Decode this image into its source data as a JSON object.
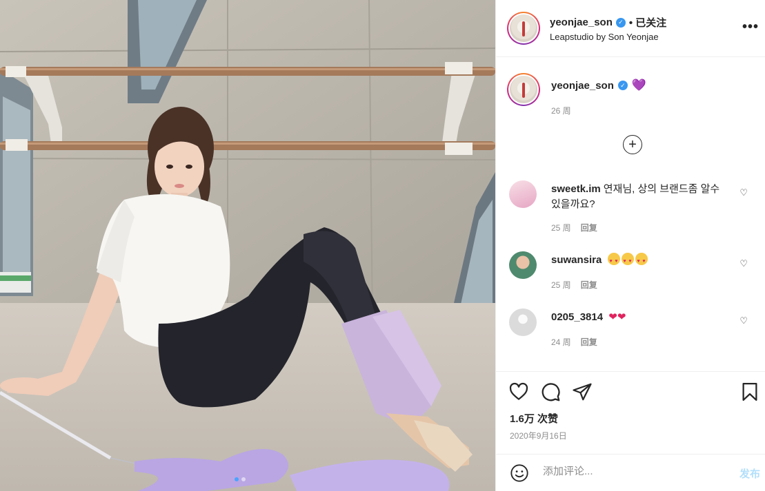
{
  "post": {
    "username": "yeonjae_son",
    "follow_status": "• 已关注",
    "location": "Leapstudio by Son Yeonjae",
    "more_label": "•••"
  },
  "caption": {
    "username": "yeonjae_son",
    "emoji": "💜",
    "time": "26 周"
  },
  "comments": [
    {
      "username": "sweetk.im",
      "text": "연재님, 상의 브랜드좀 알수 있을까요?",
      "time": "25 周",
      "reply": "回复"
    },
    {
      "username": "suwansira",
      "text": "",
      "time": "25 周",
      "reply": "回复"
    },
    {
      "username": "0205_3814",
      "text": "",
      "time": "24 周",
      "reply": "回复"
    }
  ],
  "stats": {
    "likes": "1.6万 次赞",
    "date": "2020年9月16日"
  },
  "composer": {
    "placeholder": "添加评论...",
    "post_label": "发布"
  },
  "icons": {
    "like": "heart-icon",
    "comment": "comment-icon",
    "share": "paper-plane-icon",
    "save": "bookmark-icon",
    "emoji": "smile-icon",
    "load_more": "plus-circle-icon"
  },
  "colors": {
    "verified": "#3897f0",
    "post_button_disabled": "#b2dffc",
    "meta_text": "#8e8e8e"
  }
}
